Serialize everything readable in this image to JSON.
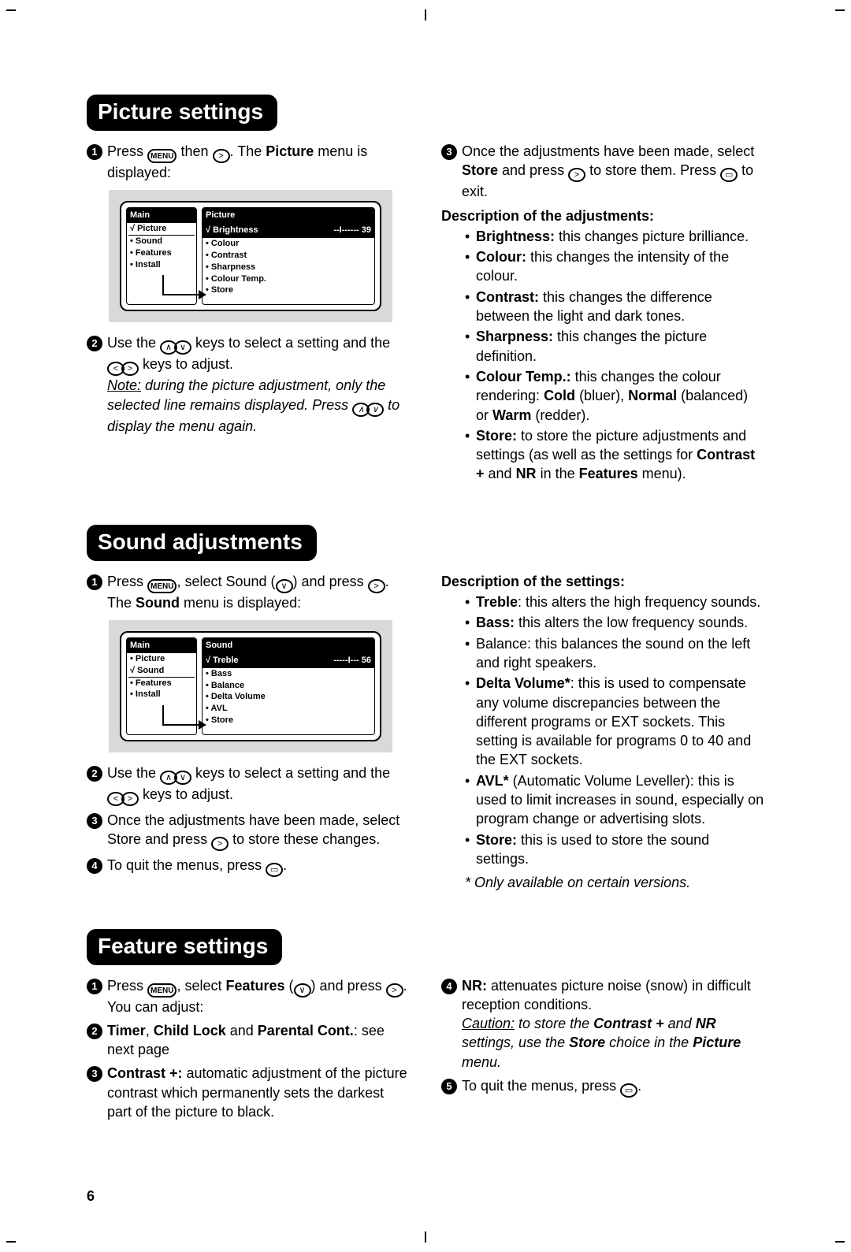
{
  "page_number": "6",
  "icons": {
    "menu": "MENU",
    "up": "∧",
    "down": "∨",
    "left": "<",
    "right": ">",
    "exit": "▭"
  },
  "picture": {
    "heading": "Picture settings",
    "step1_a": "Press ",
    "step1_b": " then ",
    "step1_c": ". The ",
    "step1_picture": "Picture",
    "step1_d": " menu is displayed:",
    "tv_left_title": "Main",
    "tv_left_items": [
      "Picture",
      "Sound",
      "Features",
      "Install"
    ],
    "tv_left_selected_index": 0,
    "tv_right_title": "Picture",
    "tv_right_selected": "Brightness",
    "tv_right_slider": "--I------",
    "tv_right_value": "39",
    "tv_right_items": [
      "Colour",
      "Contrast",
      "Sharpness",
      "Colour Temp.",
      "Store"
    ],
    "step2_a": "Use the ",
    "step2_b": " keys to select a setting and the ",
    "step2_c": " keys to adjust.",
    "note_label": "Note:",
    "note_a": " during the picture adjustment, only the selected line remains displayed. Press ",
    "note_b": " to display the menu again.",
    "step3_a": "Once the adjustments have been made, select ",
    "step3_store": "Store",
    "step3_b": " and press ",
    "step3_c": " to store them. Press ",
    "step3_d": " to exit.",
    "desc_heading": "Description of the adjustments:",
    "desc": [
      {
        "term": "Brightness:",
        "text": " this changes picture brilliance."
      },
      {
        "term": "Colour:",
        "text": " this changes the intensity of the colour."
      },
      {
        "term": "Contrast:",
        "text": " this changes the difference between the light and dark tones."
      },
      {
        "term": "Sharpness:",
        "text": " this changes the picture definition."
      },
      {
        "term": "Colour Temp.:",
        "text_a": " this changes the colour rendering: ",
        "b1": "Cold",
        "t1": " (bluer), ",
        "b2": "Normal",
        "t2": " (balanced) or ",
        "b3": "Warm",
        "t3": " (redder)."
      },
      {
        "term": "Store:",
        "text_a": " to store the picture adjustments and settings (as well as the settings for ",
        "b1": "Contrast +",
        "t1": " and ",
        "b2": "NR",
        "t2": " in the ",
        "b3": "Features",
        "t3": " menu)."
      }
    ]
  },
  "sound": {
    "heading": "Sound adjustments",
    "step1_a": "Press ",
    "step1_b": ", select Sound (",
    "step1_c": ") and press ",
    "step1_d": ". The ",
    "step1_sound": "Sound",
    "step1_e": " menu is displayed:",
    "tv_left_title": "Main",
    "tv_left_items": [
      "Picture",
      "Sound",
      "Features",
      "Install"
    ],
    "tv_left_selected_index": 1,
    "tv_right_title": "Sound",
    "tv_right_selected": "Treble",
    "tv_right_slider": "-----I---",
    "tv_right_value": "56",
    "tv_right_items": [
      "Bass",
      "Balance",
      "Delta Volume",
      "AVL",
      "Store"
    ],
    "step2_a": "Use the ",
    "step2_b": " keys to select a setting and the ",
    "step2_c": " keys to adjust.",
    "step3_a": "Once the adjustments have been made, select Store and press ",
    "step3_b": " to store these changes.",
    "step4_a": "To quit the menus, press ",
    "step4_b": ".",
    "desc_heading": "Description of the settings:",
    "desc": [
      {
        "term": "Treble",
        "text": ": this alters the high frequency sounds."
      },
      {
        "term": "Bass:",
        "text": " this alters the low frequency sounds."
      },
      {
        "term": "",
        "text": "Balance: this balances the sound on the left and right speakers."
      },
      {
        "term": "Delta Volume*",
        "text": ": this is used to compensate any volume discrepancies between the different programs or EXT sockets. This setting is available for programs 0 to 40 and the EXT sockets."
      },
      {
        "term": "AVL*",
        "text": " (Automatic Volume Leveller): this is used to limit increases in sound, especially on program change or advertising slots."
      },
      {
        "term": "Store:",
        "text": " this is used to store the sound settings."
      }
    ],
    "footnote": "* Only available on certain versions."
  },
  "feature": {
    "heading": "Feature settings",
    "step1_a": "Press ",
    "step1_b": ", select ",
    "step1_features": "Features",
    "step1_c": " (",
    "step1_d": ") and press ",
    "step1_e": ". You can adjust:",
    "step2_a": "Timer",
    "step2_b": ", ",
    "step2_c": "Child Lock",
    "step2_d": " and ",
    "step2_e": "Parental Cont.",
    "step2_f": ": see next page",
    "step3_a": "Contrast +:",
    "step3_b": " automatic adjustment of the picture contrast which permanently sets the darkest part of the picture to black.",
    "step4_a": "NR:",
    "step4_b": " attenuates picture noise (snow) in difficult reception conditions.",
    "caution_label": "Caution:",
    "caution_a": " to store the ",
    "caution_b1": "Contrast +",
    "caution_b": " and ",
    "caution_b2": "NR",
    "caution_c": " settings, use the ",
    "caution_b3": "Store",
    "caution_d": " choice in the ",
    "caution_b4": "Picture",
    "caution_e": " menu.",
    "step5_a": "To quit the menus, press ",
    "step5_b": "."
  }
}
